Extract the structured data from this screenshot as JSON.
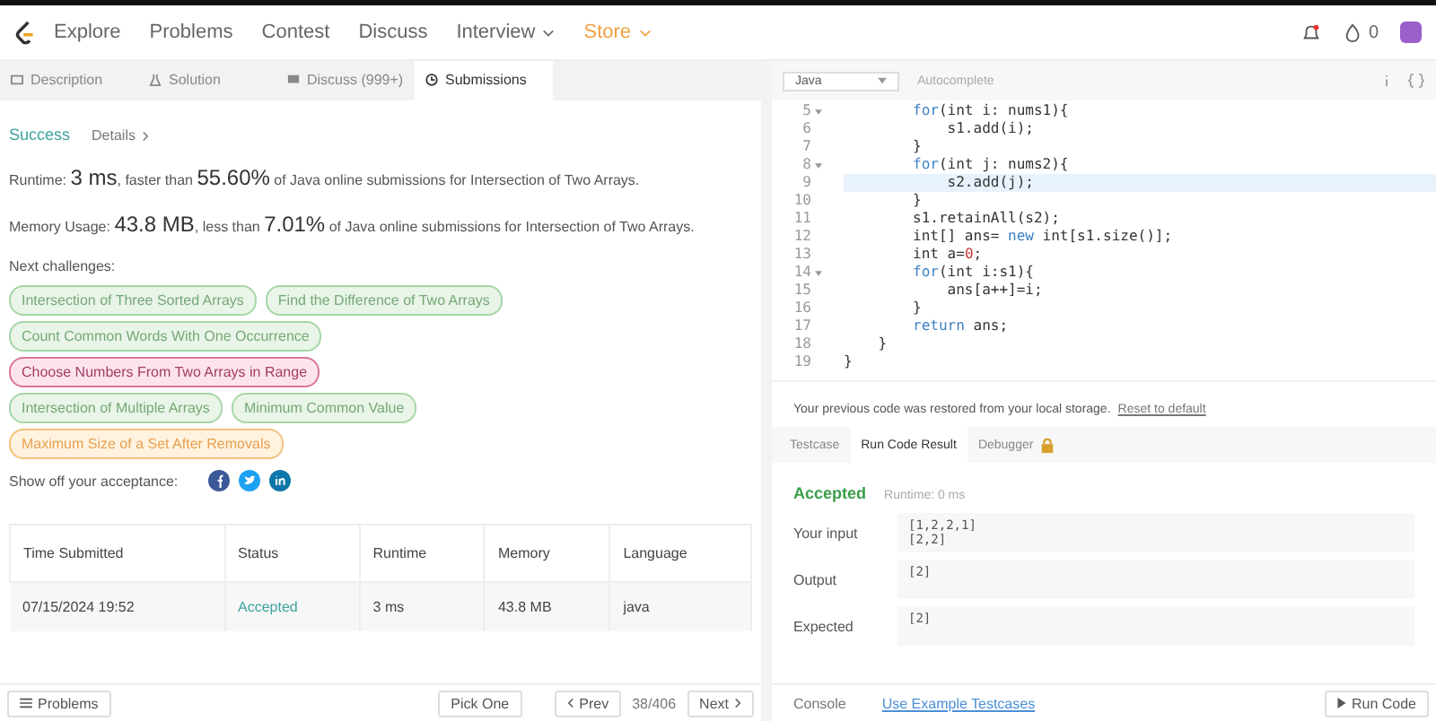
{
  "nav": {
    "items": [
      {
        "label": "Explore",
        "kind": "plain"
      },
      {
        "label": "Problems",
        "kind": "plain"
      },
      {
        "label": "Contest",
        "kind": "plain"
      },
      {
        "label": "Discuss",
        "kind": "plain"
      },
      {
        "label": "Interview",
        "kind": "dropdown"
      },
      {
        "label": "Store",
        "kind": "store"
      }
    ],
    "coins": "0"
  },
  "tabs": [
    {
      "label": "Description",
      "selected": false
    },
    {
      "label": "Solution",
      "selected": false
    },
    {
      "label": "Discuss (999+)",
      "selected": false
    },
    {
      "label": "Submissions",
      "selected": true
    }
  ],
  "result": {
    "status": "Success",
    "details": "Details",
    "runtime": "Runtime: **3 ms**, faster than **55.60%** of Java online submissions for Intersection of Two Arrays.",
    "memory": "Memory Usage: **43.8 MB**, less than **7.01%** of Java online submissions for Intersection of Two Arrays."
  },
  "next": {
    "heading": "Next challenges:",
    "rows": [
      [
        {
          "label": "Intersection of Three Sorted Arrays",
          "kind": "easy"
        },
        {
          "label": "Find the Difference of Two Arrays",
          "kind": "easy"
        }
      ],
      [
        {
          "label": "Count Common Words With One Occurrence",
          "kind": "easy"
        }
      ],
      [
        {
          "label": "Choose Numbers From Two Arrays in Range",
          "kind": "hard"
        }
      ],
      [
        {
          "label": "Intersection of Multiple Arrays",
          "kind": "easy"
        },
        {
          "label": "Minimum Common Value",
          "kind": "easy"
        }
      ],
      [
        {
          "label": "Maximum Size of a Set After Removals",
          "kind": "medium"
        }
      ]
    ]
  },
  "share": {
    "label": "Show off your acceptance:"
  },
  "table": {
    "columns": [
      "Time Submitted",
      "Status",
      "Runtime",
      "Memory",
      "Language"
    ],
    "rows": [
      [
        "07/15/2024 19:52",
        "Accepted",
        "3 ms",
        "43.8 MB",
        "java"
      ]
    ]
  },
  "left_footer": {
    "problems": "Problems",
    "pick": "Pick One",
    "prev": "Prev",
    "count": "38/406",
    "next": "Next"
  },
  "editor": {
    "language": "Java",
    "autocomplete": "Autocomplete",
    "lines": [
      {
        "n": "5",
        "fold": true,
        "highlighted": false,
        "tokens": [
          {
            "t": "        for",
            "kind": "keyword"
          },
          {
            "t": "(int i: nums1){",
            "kind": "plain"
          }
        ]
      },
      {
        "n": "6",
        "fold": false,
        "highlighted": false,
        "tokens": [
          {
            "t": "            s1.add(i);",
            "kind": "plain"
          }
        ]
      },
      {
        "n": "7",
        "fold": false,
        "highlighted": false,
        "tokens": [
          {
            "t": "        }",
            "kind": "plain"
          }
        ]
      },
      {
        "n": "8",
        "fold": true,
        "highlighted": false,
        "tokens": [
          {
            "t": "        for",
            "kind": "keyword"
          },
          {
            "t": "(int j: nums2){",
            "kind": "plain"
          }
        ]
      },
      {
        "n": "9",
        "fold": false,
        "highlighted": true,
        "tokens": [
          {
            "t": "            s2.add(j);",
            "kind": "plain"
          }
        ]
      },
      {
        "n": "10",
        "fold": false,
        "highlighted": false,
        "tokens": [
          {
            "t": "        }",
            "kind": "plain"
          }
        ]
      },
      {
        "n": "11",
        "fold": false,
        "highlighted": false,
        "tokens": [
          {
            "t": "        s1.retainAll(s2);",
            "kind": "plain"
          }
        ]
      },
      {
        "n": "12",
        "fold": false,
        "highlighted": false,
        "tokens": [
          {
            "t": "        int[] ans= ",
            "kind": "plain"
          },
          {
            "t": "new",
            "kind": "keyword"
          },
          {
            "t": " int[s1.size()];",
            "kind": "plain"
          }
        ]
      },
      {
        "n": "13",
        "fold": false,
        "highlighted": false,
        "tokens": [
          {
            "t": "        int a=",
            "kind": "plain"
          },
          {
            "t": "0",
            "kind": "number"
          },
          {
            "t": ";",
            "kind": "plain"
          }
        ]
      },
      {
        "n": "14",
        "fold": true,
        "highlighted": false,
        "tokens": [
          {
            "t": "        for",
            "kind": "keyword"
          },
          {
            "t": "(int i:s1){",
            "kind": "plain"
          }
        ]
      },
      {
        "n": "15",
        "fold": false,
        "highlighted": false,
        "tokens": [
          {
            "t": "            ans[a++]=i;",
            "kind": "plain"
          }
        ]
      },
      {
        "n": "16",
        "fold": false,
        "highlighted": false,
        "tokens": [
          {
            "t": "        }",
            "kind": "plain"
          }
        ]
      },
      {
        "n": "17",
        "fold": false,
        "highlighted": false,
        "tokens": [
          {
            "t": "        return",
            "kind": "keyword"
          },
          {
            "t": " ans;",
            "kind": "plain"
          }
        ]
      },
      {
        "n": "18",
        "fold": false,
        "highlighted": false,
        "tokens": [
          {
            "t": "    }",
            "kind": "plain"
          }
        ]
      },
      {
        "n": "19",
        "fold": false,
        "highlighted": false,
        "tokens": [
          {
            "t": "}",
            "kind": "plain"
          }
        ]
      }
    ],
    "restore_note": "Your previous code was restored from your local storage.",
    "reset_link": "Reset to default"
  },
  "console_tabs": [
    {
      "label": "Testcase",
      "selected": false,
      "locked": false
    },
    {
      "label": "Run Code Result",
      "selected": true,
      "locked": false
    },
    {
      "label": "Debugger",
      "selected": false,
      "locked": true
    }
  ],
  "run_result": {
    "status": "Accepted",
    "runtime": "Runtime: 0 ms",
    "fields": [
      {
        "label": "Your input",
        "lines": [
          "[1,2,2,1]",
          "[2,2]"
        ]
      },
      {
        "label": "Output",
        "lines": [
          "[2]"
        ]
      },
      {
        "label": "Expected",
        "lines": [
          "[2]"
        ]
      }
    ]
  },
  "right_footer": {
    "console": "Console",
    "example": "Use Example Testcases",
    "run": "Run Code"
  }
}
